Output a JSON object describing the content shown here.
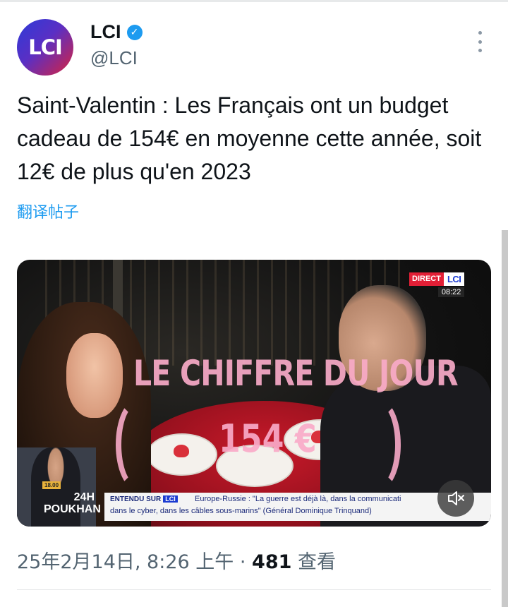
{
  "account": {
    "avatar_text": "LCI",
    "display_name": "LCI",
    "handle": "@LCI",
    "verified": true
  },
  "tweet": {
    "text": "Saint-Valentin : Les Français ont un budget cadeau de 154€ en moyenne cette année, soit 12€ de plus qu'en 2023",
    "translate_label": "翻译帖子"
  },
  "media": {
    "overlay_title": "LE CHIFFRE DU JOUR",
    "overlay_value": "154 €",
    "live_label": "DIRECT",
    "channel_logo": "LCI",
    "live_time": "08:22",
    "inset_badge": "18.00",
    "inset_show": "24H POUKHAN",
    "ticker_label": "ENTENDU SUR",
    "ticker_logo": "LCI",
    "ticker_line1": "Europe-Russie : \"La guerre est déjà là, dans la communicati",
    "ticker_line2": "dans le cyber, dans les câbles sous-marins\" (Général Dominique Trinquand)",
    "mute_icon": "volume-muted-icon"
  },
  "meta": {
    "timestamp": "25年2月14日, 8:26 上午 · ",
    "views_count": "481",
    "views_label": " 查看"
  },
  "colors": {
    "accent": "#1d9bf0",
    "text_primary": "#0f1419",
    "text_secondary": "#536471"
  }
}
